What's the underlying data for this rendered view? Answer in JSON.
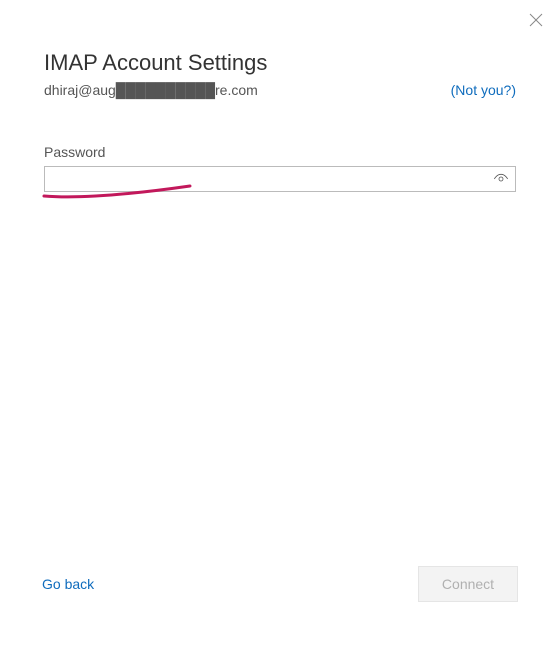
{
  "header": {
    "title": "IMAP Account Settings",
    "email": "dhiraj@aug██████████re.com",
    "not_you": "(Not you?)"
  },
  "form": {
    "password_label": "Password",
    "password_value": "",
    "password_placeholder": ""
  },
  "footer": {
    "go_back": "Go back",
    "connect": "Connect"
  },
  "icons": {
    "close": "close-icon",
    "eye": "eye-icon"
  }
}
